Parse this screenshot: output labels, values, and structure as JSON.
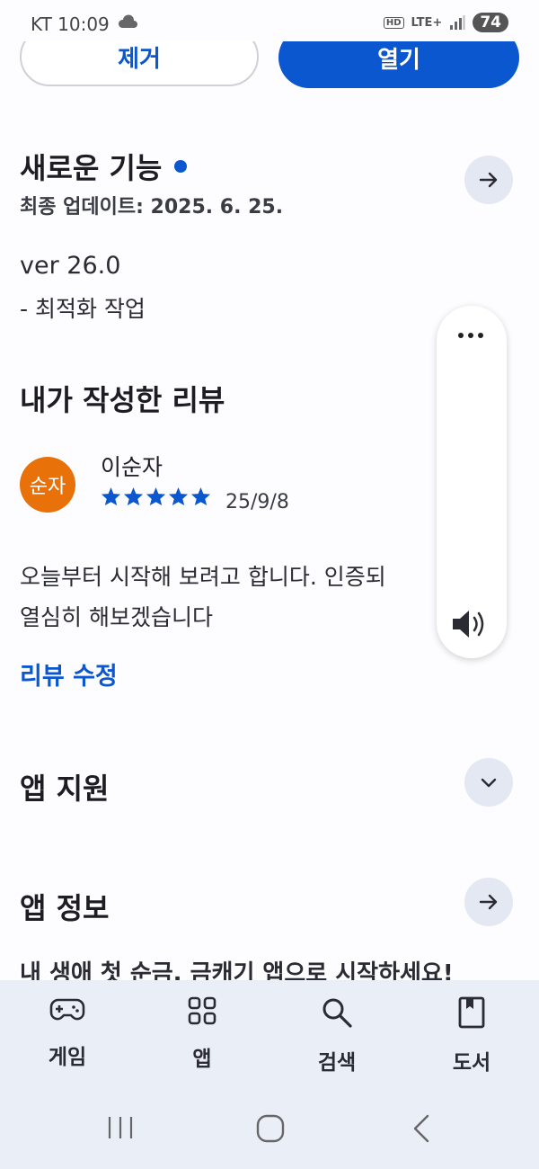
{
  "status_bar": {
    "carrier_time": "KT 10:09",
    "hd": "HD",
    "lte": "LTE+",
    "battery": "74"
  },
  "actions": {
    "remove_label": "제거",
    "open_label": "열기"
  },
  "whats_new": {
    "title": "새로운 기능",
    "updated": "최종 업데이트: 2025. 6. 25.",
    "version": "ver 26.0",
    "note": "- 최적화 작업"
  },
  "my_review": {
    "title": "내가 작성한 리뷰",
    "avatar_text": "순자",
    "reviewer": "이순자",
    "rating": 5,
    "date": "25/9/8",
    "text_line1": "오늘부터 시작해 보려고 합니다. 인증되",
    "text_line2": "열심히 해보겠습니다",
    "edit_label": "리뷰 수정"
  },
  "app_support": {
    "title": "앱 지원"
  },
  "app_info": {
    "title": "앱 정보",
    "description": "내 생애 첫 순금, 금캐기 앱으로 시작하세요!"
  },
  "bottom_nav": {
    "items": [
      {
        "label": "게임",
        "icon": "gamepad-icon"
      },
      {
        "label": "앱",
        "icon": "apps-grid-icon"
      },
      {
        "label": "검색",
        "icon": "search-icon"
      },
      {
        "label": "도서",
        "icon": "book-icon"
      }
    ]
  },
  "colors": {
    "accent": "#0b57d0",
    "avatar": "#e8710a",
    "nav_bg": "#eaeef6"
  }
}
